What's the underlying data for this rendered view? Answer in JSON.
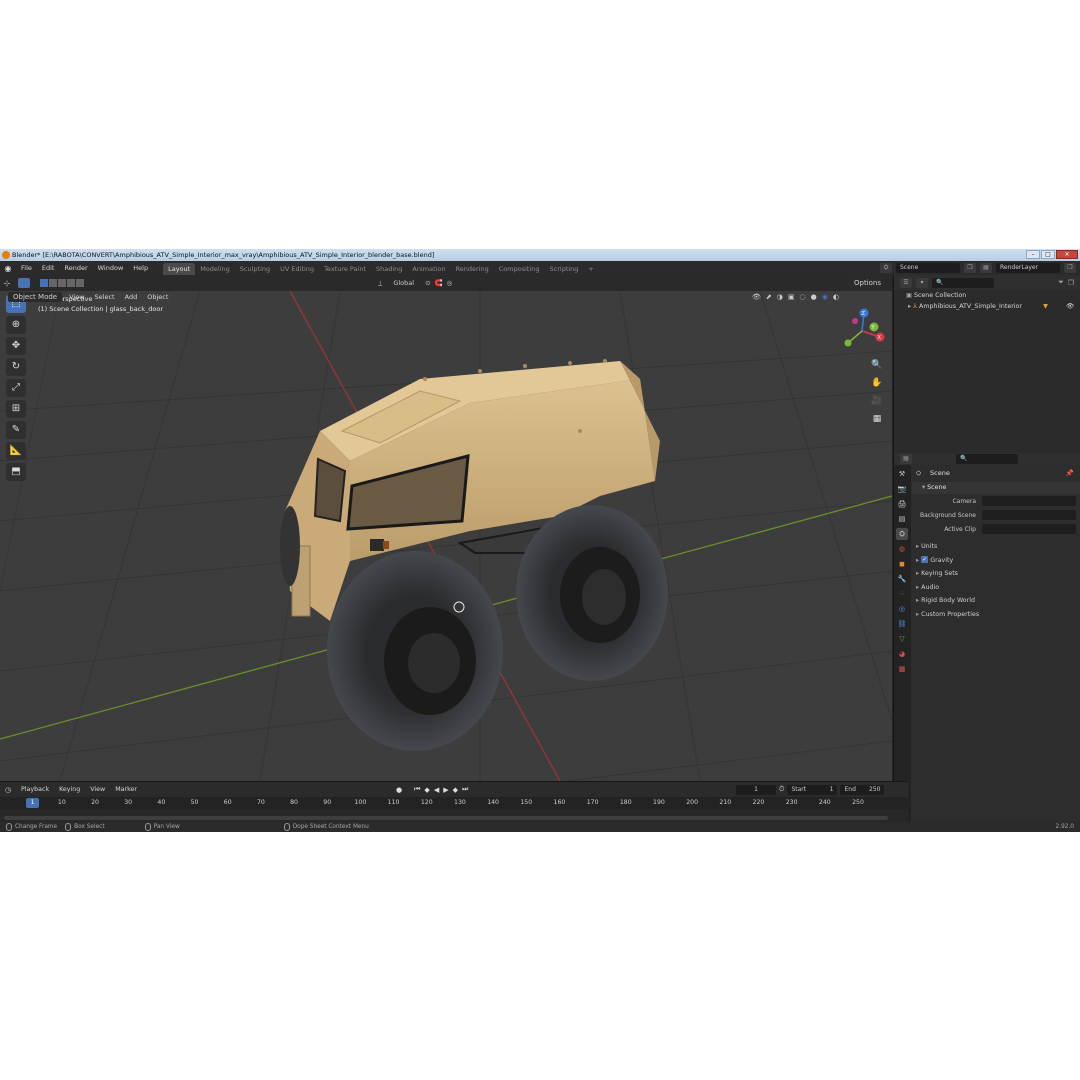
{
  "window": {
    "title": "Blender* [E:\\RABOTA\\CONVERT\\Amphibious_ATV_Simple_Interior_max_vray\\Amphibious_ATV_Simple_Interior_blender_base.blend]",
    "min": "–",
    "max": "□",
    "close": "✕"
  },
  "menu": [
    "File",
    "Edit",
    "Render",
    "Window",
    "Help"
  ],
  "workspaces": [
    "Layout",
    "Modeling",
    "Sculpting",
    "UV Editing",
    "Texture Paint",
    "Shading",
    "Animation",
    "Rendering",
    "Compositing",
    "Scripting"
  ],
  "workspace_add": "+",
  "scene_field": "Scene",
  "view_layer_field": "RenderLayer",
  "viewport": {
    "mode": "Object Mode",
    "menus": [
      "View",
      "Select",
      "Add",
      "Object"
    ],
    "transform_orientation": "Global",
    "options": "Options",
    "perspective": "User Perspective",
    "collection_info": "(1) Scene Collection | glass_back_door",
    "gizmo": {
      "x": "X",
      "y": "Y",
      "z": "Z"
    }
  },
  "outliner": {
    "root": "Scene Collection",
    "items": [
      "Amphibious_ATV_Simple_Interior"
    ]
  },
  "properties": {
    "context": "Scene",
    "panel": "Scene",
    "rows": [
      {
        "label": "Camera",
        "value": ""
      },
      {
        "label": "Background Scene",
        "value": ""
      },
      {
        "label": "Active Clip",
        "value": ""
      }
    ],
    "subpanels": [
      "Units",
      "Gravity",
      "Keying Sets",
      "Audio",
      "Rigid Body World",
      "Custom Properties"
    ],
    "gravity_checked": true
  },
  "timeline": {
    "menus": [
      "Playback",
      "Keying",
      "View",
      "Marker"
    ],
    "current_frame": "1",
    "start_label": "Start",
    "start": "1",
    "end_label": "End",
    "end": "250",
    "ticks": [
      "1",
      "10",
      "20",
      "30",
      "40",
      "50",
      "60",
      "70",
      "80",
      "90",
      "100",
      "110",
      "120",
      "130",
      "140",
      "150",
      "160",
      "170",
      "180",
      "190",
      "200",
      "210",
      "220",
      "230",
      "240",
      "250"
    ]
  },
  "statusbar": {
    "items": [
      "Change Frame",
      "Box Select",
      "Pan View",
      "Dope Sheet Context Menu"
    ],
    "version": "2.92.0"
  },
  "colors": {
    "accent": "#4772b3",
    "x_axis": "#d83a4a",
    "y_axis": "#7fb73a",
    "z_axis": "#3b7bd8",
    "vehicle_body": "#d6b887",
    "tire": "#3a3c40"
  }
}
